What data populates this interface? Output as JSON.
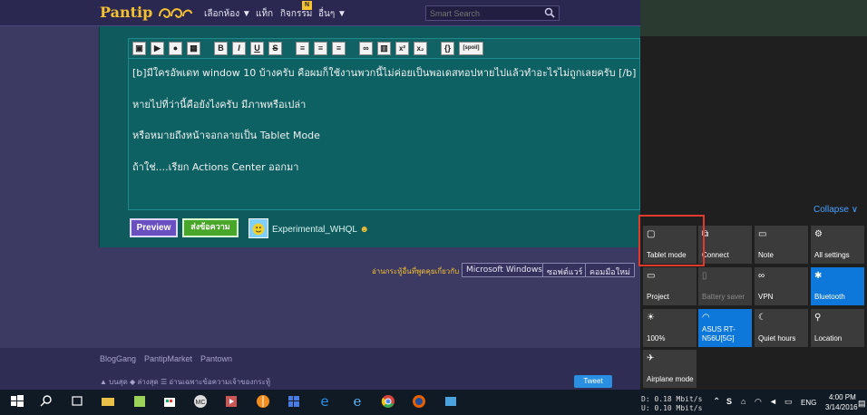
{
  "nav": {
    "logo_text": "Pantip",
    "items": [
      "เลือกห้อง ▼",
      "แท็ก",
      "กิจกรรม",
      "อื่นๆ ▼"
    ],
    "badge": "N",
    "search_placeholder": "Smart Search"
  },
  "toolbar": {
    "bold": "B",
    "italic": "I",
    "underline": "U",
    "strike": "S",
    "sup": "x²",
    "sub": "x₂",
    "code": "{}",
    "spoil": "[spoil]"
  },
  "editor": {
    "lines": [
      "[b]มีใครอัพเดท window 10 บ้างครับ คือผมก็ใช้งานพวกนี้ไม่ค่อยเป็นพอเดสทอปหายไปแล้วทำอะไรไม่ถูกเลยครับ [/b]",
      "หายไปที่ว่านี้คือยังไงครับ มีภาพหรือเปล่า",
      "หรือหมายถึงหน้าจอกลายเป็น Tablet Mode",
      "ถ้าใช่....เรียก Actions Center ออกมา"
    ]
  },
  "buttons": {
    "preview": "Preview",
    "send": "ส่งข้อความ"
  },
  "user": {
    "name": "Experimental_WHQL"
  },
  "tags": {
    "label": "อ่านกระทู้อื่นที่พูดคุยเกี่ยวกับ",
    "items": [
      "Microsoft Windows",
      "ซอฟต์แวร์",
      "คอมมือใหม่"
    ]
  },
  "footer": {
    "links": [
      "BlogGang",
      "PantipMarket",
      "Pantown"
    ],
    "bottom": "▲ บนสุด   ◆ ล่างสุด   ☰ อ่านเฉพาะข้อความเจ้าของกระทู้",
    "tweet": "Tweet"
  },
  "action_center": {
    "collapse": "Collapse ∨",
    "tiles": [
      {
        "label": "Tablet mode",
        "on": false,
        "dim": false,
        "icon": "tablet-icon"
      },
      {
        "label": "Connect",
        "on": false,
        "dim": false,
        "icon": "connect-icon"
      },
      {
        "label": "Note",
        "on": false,
        "dim": false,
        "icon": "note-icon"
      },
      {
        "label": "All settings",
        "on": false,
        "dim": false,
        "icon": "gear-icon"
      },
      {
        "label": "Project",
        "on": false,
        "dim": false,
        "icon": "project-icon"
      },
      {
        "label": "Battery saver",
        "on": false,
        "dim": true,
        "icon": "battery-icon"
      },
      {
        "label": "VPN",
        "on": false,
        "dim": false,
        "icon": "vpn-icon"
      },
      {
        "label": "Bluetooth",
        "on": true,
        "dim": false,
        "icon": "bluetooth-icon"
      },
      {
        "label": "100%",
        "on": false,
        "dim": false,
        "icon": "brightness-icon"
      },
      {
        "label": "ASUS RT-N56U[5G]",
        "on": true,
        "dim": false,
        "icon": "wifi-icon"
      },
      {
        "label": "Quiet hours",
        "on": false,
        "dim": false,
        "icon": "moon-icon"
      },
      {
        "label": "Location",
        "on": false,
        "dim": false,
        "icon": "location-icon"
      },
      {
        "label": "Airplane mode",
        "on": false,
        "dim": false,
        "icon": "airplane-icon"
      }
    ]
  },
  "taskbar": {
    "net_down": "D:   0.18 Mbit/s",
    "net_up": "U:   0.10 Mbit/s",
    "lang": "ENG",
    "time": "4:00 PM",
    "date": "3/14/2016"
  },
  "colors": {
    "page_bg": "#3c3963",
    "editor_bg": "#0d6163",
    "accent": "#0d78d9",
    "highlight": "#e03a2d"
  }
}
